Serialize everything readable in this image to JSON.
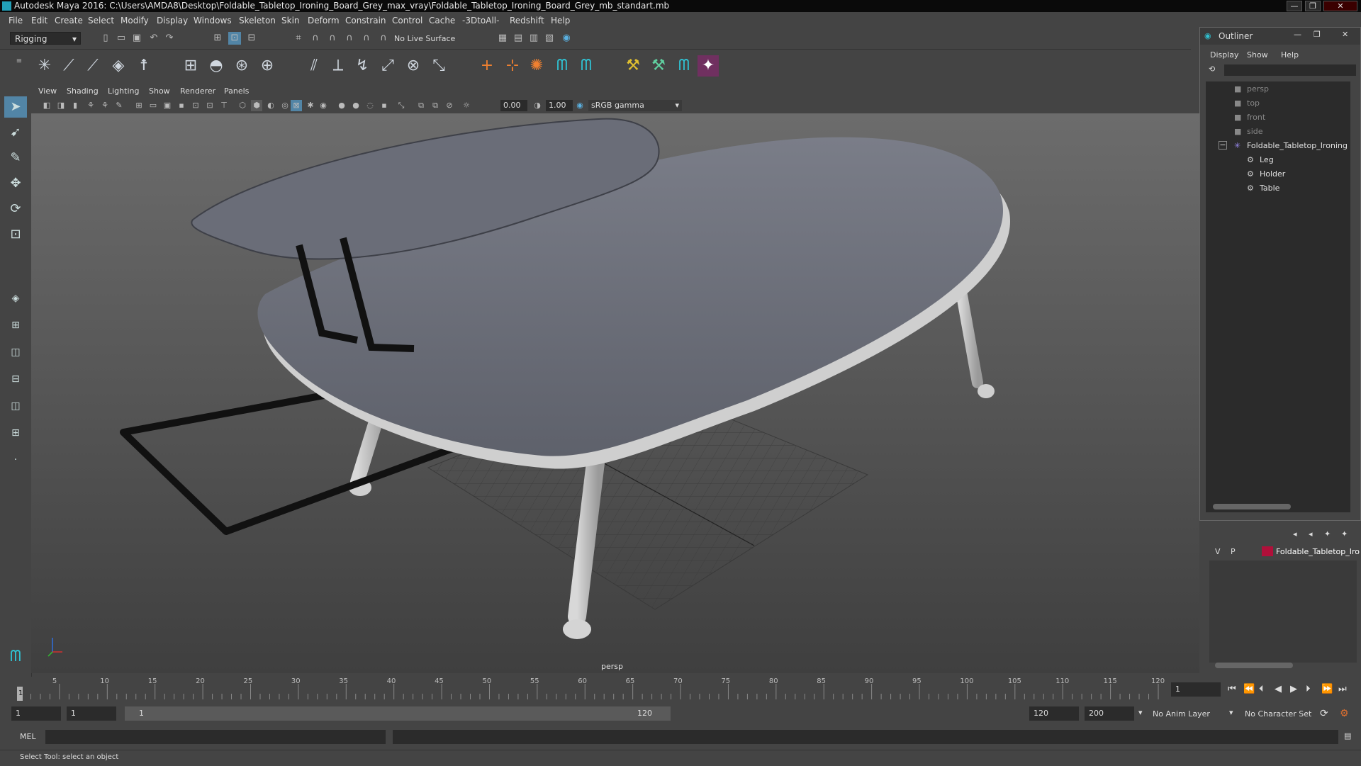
{
  "window": {
    "title": "Autodesk Maya 2016: C:\\Users\\AMDA8\\Desktop\\Foldable_Tabletop_Ironing_Board_Grey_max_vray\\Foldable_Tabletop_Ironing_Board_Grey_mb_standart.mb",
    "minimize": "—",
    "maximize": "❐",
    "close": "✕"
  },
  "menubar": [
    "File",
    "Edit",
    "Create",
    "Select",
    "Modify",
    "Display",
    "Windows",
    "Skeleton",
    "Skin",
    "Deform",
    "Constrain",
    "Control",
    "Cache",
    "-3DtoAll-",
    "Redshift",
    "Help"
  ],
  "statusline": {
    "menuset": "Rigging",
    "live_surface": "No Live Surface"
  },
  "panel": {
    "menus": [
      "View",
      "Shading",
      "Lighting",
      "Show",
      "Renderer",
      "Panels"
    ],
    "exposure": "0.00",
    "gamma": "1.00",
    "colorspace": "sRGB gamma",
    "camera_label": "persp"
  },
  "outliner": {
    "title": "Outliner",
    "menus": [
      "Display",
      "Show",
      "Help"
    ],
    "items": [
      {
        "label": "persp",
        "dim": true
      },
      {
        "label": "top",
        "dim": true
      },
      {
        "label": "front",
        "dim": true
      },
      {
        "label": "side",
        "dim": true
      },
      {
        "label": "Foldable_Tabletop_Ironing",
        "dim": false
      },
      {
        "label": "Leg",
        "dim": false
      },
      {
        "label": "Holder",
        "dim": false
      },
      {
        "label": "Table",
        "dim": false
      }
    ],
    "collapse": "−"
  },
  "layers": {
    "v": "V",
    "p": "P",
    "layer_name": "Foldable_Tabletop_Iro",
    "layer_color": "#b0103a"
  },
  "timeline": {
    "ticks": [
      "5",
      "10",
      "15",
      "20",
      "25",
      "30",
      "35",
      "40",
      "45",
      "50",
      "55",
      "60",
      "65",
      "70",
      "75",
      "80",
      "85",
      "90",
      "95",
      "100",
      "105",
      "110",
      "115",
      "120"
    ],
    "current_frame": "1",
    "start_marker": "1"
  },
  "range": {
    "start": "1",
    "playback_start": "1",
    "slider_start": "1",
    "slider_end": "120",
    "playback_end": "120",
    "end": "200",
    "anim_layer": "No Anim Layer",
    "character_set": "No Character Set"
  },
  "command": {
    "lang": "MEL"
  },
  "help": {
    "text": "Select Tool: select an object"
  },
  "colors": {
    "board": "#6e717c",
    "background": "#444444"
  }
}
